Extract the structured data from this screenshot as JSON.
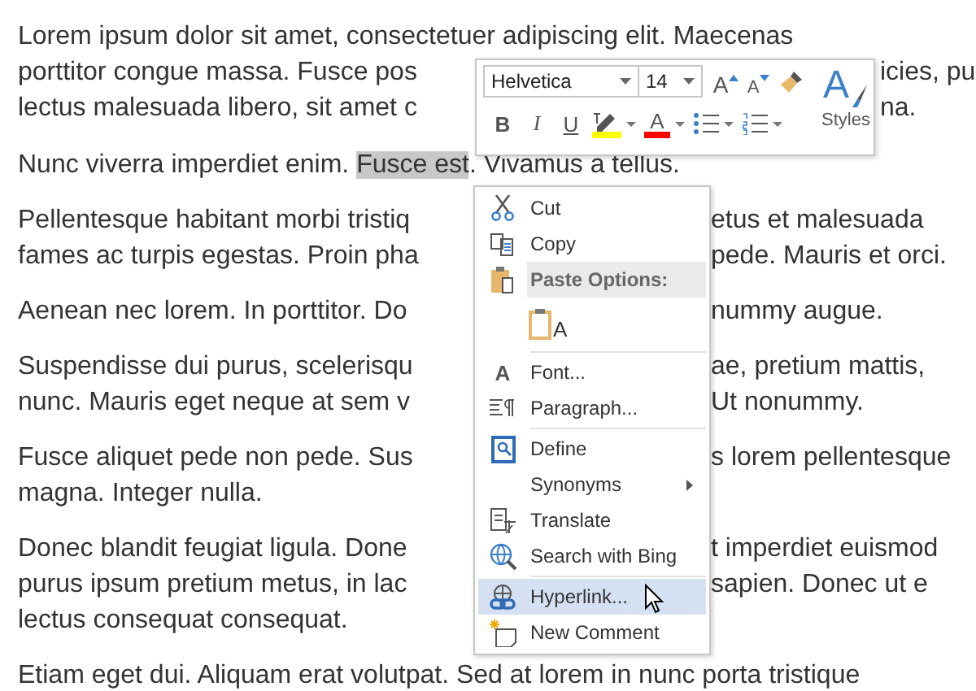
{
  "document": {
    "paragraphs": [
      {
        "lines": [
          {
            "segments": [
              {
                "text": "Lorem ipsum dolor sit amet, consectetuer adipiscing elit. Maecenas",
                "highlighted": false
              }
            ]
          },
          {
            "segments": [
              {
                "text": "porttitor congue massa. Fusce pos",
                "highlighted": false
              }
            ],
            "right": "icies, pu"
          },
          {
            "segments": [
              {
                "text": "lectus malesuada libero, sit amet c",
                "highlighted": false
              }
            ],
            "right": "na."
          }
        ]
      },
      {
        "lines": [
          {
            "segments": [
              {
                "text": "Nunc viverra imperdiet enim. ",
                "highlighted": false
              },
              {
                "text": "Fusce est",
                "highlighted": true
              },
              {
                "text": ". Vivamus a tellus.",
                "highlighted": false
              }
            ]
          }
        ]
      },
      {
        "lines": [
          {
            "segments": [
              {
                "text": "Pellentesque habitant morbi tristiq",
                "highlighted": false
              }
            ],
            "right": "etus et malesuada"
          },
          {
            "segments": [
              {
                "text": "fames ac turpis egestas. Proin pha",
                "highlighted": false
              }
            ],
            "right": "pede. Mauris et orci."
          }
        ]
      },
      {
        "lines": [
          {
            "segments": [
              {
                "text": "Aenean nec lorem. In porttitor. Do",
                "highlighted": false
              }
            ],
            "right": "nummy augue."
          }
        ]
      },
      {
        "lines": [
          {
            "segments": [
              {
                "text": "Suspendisse dui purus, scelerisqu",
                "highlighted": false
              }
            ],
            "right": "ae, pretium mattis,"
          },
          {
            "segments": [
              {
                "text": "nunc. Mauris eget neque at sem v",
                "highlighted": false
              }
            ],
            "right": "Ut nonummy."
          }
        ]
      },
      {
        "lines": [
          {
            "segments": [
              {
                "text": "Fusce aliquet pede non pede. Sus",
                "highlighted": false
              }
            ],
            "right": "s lorem pellentesque"
          },
          {
            "segments": [
              {
                "text": "magna. Integer nulla.",
                "highlighted": false
              }
            ]
          }
        ]
      },
      {
        "lines": [
          {
            "segments": [
              {
                "text": "Donec blandit feugiat ligula. Done",
                "highlighted": false
              }
            ],
            "right": "t imperdiet euismod"
          },
          {
            "segments": [
              {
                "text": "purus ipsum pretium metus, in lac",
                "highlighted": false
              }
            ],
            "right": "sapien. Donec ut e"
          },
          {
            "segments": [
              {
                "text": "lectus consequat consequat.",
                "highlighted": false
              }
            ]
          }
        ]
      },
      {
        "lines": [
          {
            "segments": [
              {
                "text": "Etiam eget dui. Aliquam erat volutpat. Sed at lorem in nunc porta tristique",
                "highlighted": false
              }
            ]
          }
        ]
      }
    ]
  },
  "mini_toolbar": {
    "font_field": {
      "value": "Helvetica"
    },
    "size_field": {
      "value": "14"
    },
    "size_buttons": [
      {
        "kind": "grow",
        "glyph": "A"
      },
      {
        "kind": "shrink",
        "glyph": "A"
      }
    ],
    "format_buttons": [
      {
        "kind": "bold",
        "label": "B"
      },
      {
        "kind": "italic",
        "label": "I"
      },
      {
        "kind": "underline",
        "label": "U"
      },
      {
        "kind": "highlight",
        "color": "#ffff00"
      },
      {
        "kind": "font_color",
        "glyph": "A",
        "color": "#ff0000"
      },
      {
        "kind": "bullets"
      },
      {
        "kind": "numbering"
      }
    ],
    "styles": {
      "glyph": "A",
      "label": "Styles"
    }
  },
  "context_menu": {
    "items": [
      {
        "kind": "cut",
        "label": "Cut",
        "selected": false
      },
      {
        "kind": "copy",
        "label": "Copy",
        "selected": false
      },
      {
        "kind": "paste_header",
        "label": "Paste Options:"
      },
      {
        "kind": "paste_option",
        "glyph": "A"
      },
      {
        "kind": "separator"
      },
      {
        "kind": "font",
        "glyph": "A",
        "label": "Font...",
        "selected": false
      },
      {
        "kind": "paragraph",
        "label": "Paragraph...",
        "selected": false
      },
      {
        "kind": "separator"
      },
      {
        "kind": "define",
        "label": "Define",
        "selected": false
      },
      {
        "kind": "synonyms",
        "label": "Synonyms",
        "selected": false
      },
      {
        "kind": "translate",
        "label": "Translate",
        "selected": false
      },
      {
        "kind": "search",
        "label": "Search with Bing",
        "selected": false
      },
      {
        "kind": "separator"
      },
      {
        "kind": "hyperlink",
        "label": "Hyperlink...",
        "selected": true
      },
      {
        "kind": "comment",
        "label": "New Comment",
        "selected": false
      }
    ]
  }
}
